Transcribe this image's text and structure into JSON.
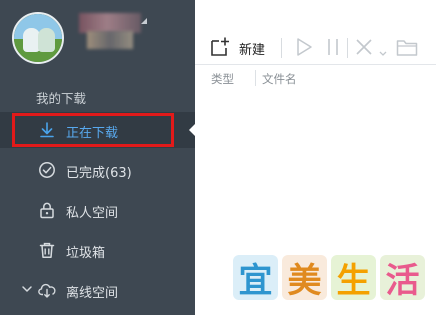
{
  "sidebar": {
    "section_label": "我的下载",
    "items": [
      {
        "label": "正在下载",
        "icon": "download-arrow-icon",
        "active": true
      },
      {
        "label": "已完成(63)",
        "icon": "check-circle-icon",
        "active": false
      },
      {
        "label": "私人空间",
        "icon": "lock-icon",
        "active": false
      },
      {
        "label": "垃圾箱",
        "icon": "trash-icon",
        "active": false
      },
      {
        "label": "离线空间",
        "icon": "cloud-download-icon",
        "active": false
      }
    ]
  },
  "toolbar": {
    "new_label": "新建",
    "buttons": [
      "new-icon",
      "play-icon",
      "pause-icon",
      "delete-icon",
      "folder-icon"
    ]
  },
  "columns": {
    "type": "类型",
    "filename": "文件名"
  },
  "watermark": {
    "chars": [
      "宜",
      "美",
      "生",
      "活"
    ]
  },
  "colors": {
    "sidebar_bg": "#3e4852",
    "active_text": "#58a9ee",
    "highlight_border": "#e21a1a"
  }
}
